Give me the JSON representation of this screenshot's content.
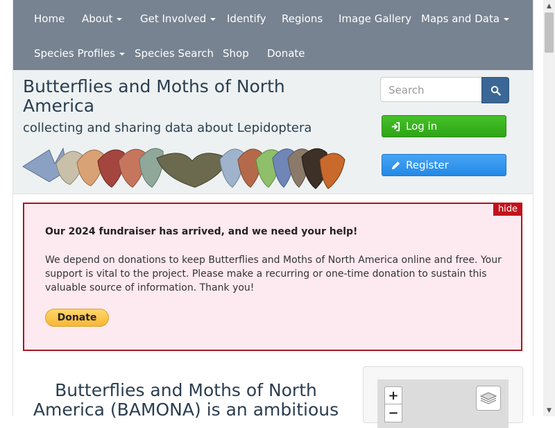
{
  "nav": {
    "items": [
      {
        "label": "Home",
        "dropdown": false
      },
      {
        "label": "About",
        "dropdown": true
      },
      {
        "label": "Get Involved",
        "dropdown": true
      },
      {
        "label": "Identify",
        "dropdown": false
      },
      {
        "label": "Regions",
        "dropdown": false
      },
      {
        "label": "Image Gallery",
        "dropdown": false
      },
      {
        "label": "Maps and Data",
        "dropdown": true
      },
      {
        "label": "Species Profiles",
        "dropdown": true
      },
      {
        "label": "Species Search",
        "dropdown": false
      },
      {
        "label": "Shop",
        "dropdown": false
      },
      {
        "label": "Donate",
        "dropdown": false
      }
    ]
  },
  "header": {
    "title": "Butterflies and Moths of North America",
    "tagline": "collecting and sharing data about Lepidoptera",
    "search_placeholder": "Search",
    "login_label": "Log in",
    "register_label": "Register"
  },
  "alert": {
    "hide_label": "hide",
    "heading": "Our 2024 fundraiser has arrived, and we need your help!",
    "body": "We depend on donations to keep Butterflies and Moths of North America online and free. Your support is vital to the project. Please make a recurring or one-time donation to sustain this valuable source of information. Thank you!",
    "donate_label": "Donate"
  },
  "intro": {
    "title": "Butterflies and Moths of North America (BAMONA) is an ambitious"
  },
  "map": {
    "zoom_in": "+",
    "zoom_out": "−"
  },
  "colors": {
    "navbar": "#778391",
    "header_bg": "#edf1f2",
    "login_green": "#2ea515",
    "register_blue": "#2389e6",
    "alert_border": "#a9161f",
    "alert_bg": "#fde9f0"
  }
}
